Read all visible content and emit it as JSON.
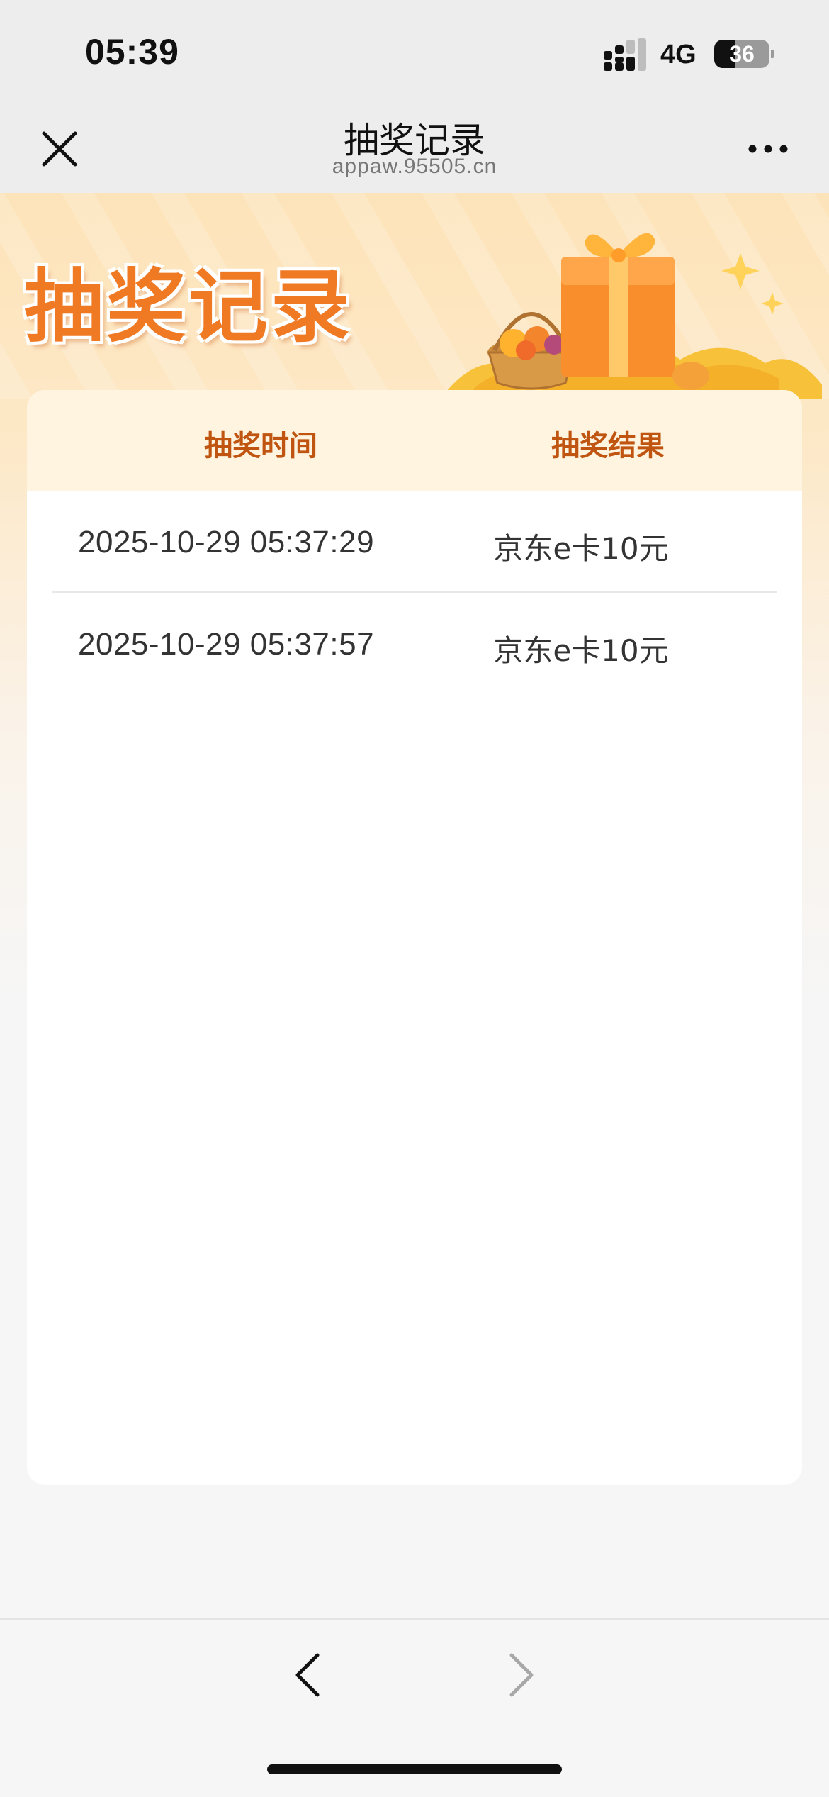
{
  "status_bar": {
    "time": "05:39",
    "network": "4G",
    "battery": "36"
  },
  "nav": {
    "title": "抽奖记录",
    "subtitle": "appaw.95505.cn"
  },
  "banner": {
    "title": "抽奖记录"
  },
  "table": {
    "headers": [
      "抽奖时间",
      "抽奖结果"
    ],
    "rows": [
      {
        "time": "2025-10-29 05:37:29",
        "result": "京东e卡10元"
      },
      {
        "time": "2025-10-29 05:37:57",
        "result": "京东e卡10元"
      }
    ]
  },
  "colors": {
    "accent": "#c05511",
    "banner_title": "#f07a24",
    "header_bg": "#fff4df"
  }
}
